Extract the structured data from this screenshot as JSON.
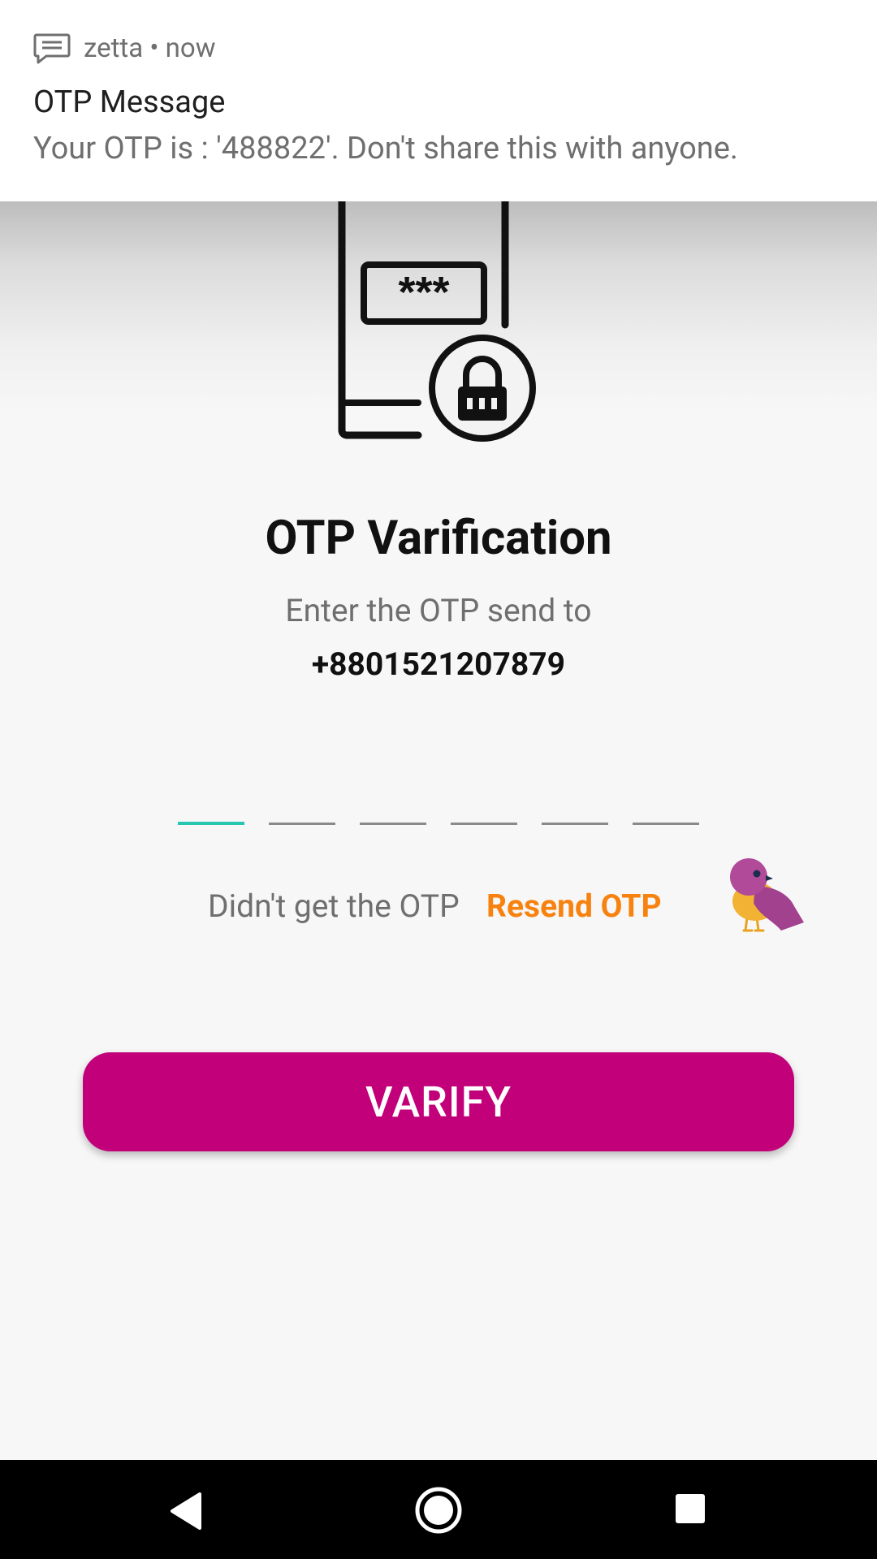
{
  "notification": {
    "app": "zetta • now",
    "title": "OTP Message",
    "body": "Your OTP is : '488822'. Don't share this with anyone.",
    "icon": "message-icon"
  },
  "screen": {
    "title": "OTP Varification",
    "subtitle": "Enter the OTP send to",
    "phone": "+8801521207879",
    "otp_digits": [
      "",
      "",
      "",
      "",
      "",
      ""
    ],
    "resend_prompt": "Didn't get the OTP",
    "resend_link": "Resend OTP",
    "verify_label": "VARIFY"
  },
  "colors": {
    "brand": "#c1007a",
    "accent": "#f7820f",
    "active_underline": "#26c6b0"
  },
  "navbar": {
    "back_icon": "back-triangle-icon",
    "home_icon": "home-circle-icon",
    "recents_icon": "recents-square-icon"
  }
}
